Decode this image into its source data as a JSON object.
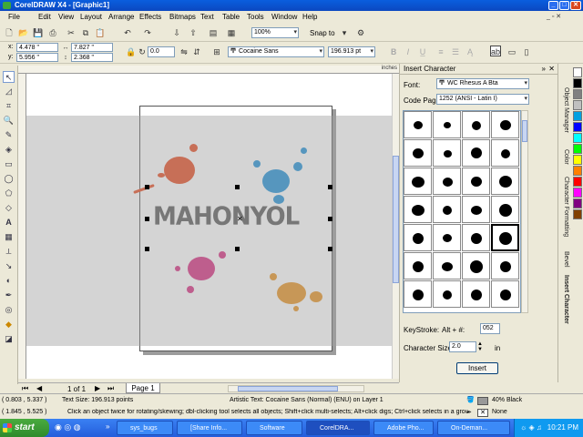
{
  "window": {
    "title": "CorelDRAW X4 - [Graphic1]"
  },
  "menu": [
    "File",
    "Edit",
    "View",
    "Layout",
    "Arrange",
    "Effects",
    "Bitmaps",
    "Text",
    "Table",
    "Tools",
    "Window",
    "Help"
  ],
  "toolbar": {
    "zoom": "100%",
    "snap_to": "Snap to",
    "x": "4.478 \"",
    "y": "5.956 \"",
    "w": "7.827 \"",
    "h": "2.368 \"",
    "rotation": "0.0",
    "font": "Cocaine Sans",
    "font_size": "196.913 pt",
    "units": "inches"
  },
  "canvas": {
    "artwork_text": "MAHONYOL"
  },
  "docker": {
    "title": "Insert Character",
    "font_label": "Font:",
    "font_value": "WC Rhesus A Bta",
    "code_page_label": "Code Page:",
    "code_page_value": "1252  (ANSI - Latin I)",
    "keystroke_label": "KeyStroke:",
    "keystroke_prefix": "Alt + #:",
    "keystroke_value": "052",
    "char_size_label": "Character Size:",
    "char_size_value": "2.0",
    "char_size_unit": "in",
    "insert_button": "Insert"
  },
  "side_tabs": [
    "Object Manager",
    "Color",
    "Character Formatting",
    "Bevel",
    "Insert Character"
  ],
  "palette_colors": [
    "#ffffff",
    "#000000",
    "#808080",
    "#c0c0c0",
    "#00a0e0",
    "#0000ff",
    "#00ffff",
    "#00ff00",
    "#ffff00",
    "#ff8000",
    "#ff0000",
    "#ff00ff",
    "#800080",
    "#804000"
  ],
  "page_nav": {
    "page_indicator": "1 of 1",
    "page_tab": "Page 1"
  },
  "status": {
    "coords": "( 0.803 , 5.337 )",
    "text_size": "Text Size: 196.913 points",
    "object_info": "Artistic Text: Cocaine Sans (Normal) (ENU) on Layer 1",
    "coords2": "( 1.845 , 5.525 )",
    "hint": "Click an object twice for rotating/skewing; dbl-clicking tool selects all objects; Shift+click multi-selects; Alt+click digs; Ctrl+click selects in a group",
    "fill": "40% Black",
    "outline": "None"
  },
  "taskbar": {
    "start": "start",
    "tasks": [
      "sys_bugs",
      "[Share Info...",
      "Software",
      "CorelDRA...",
      "Adobe Pho...",
      "On-Deman..."
    ],
    "clock": "10:21 PM"
  }
}
